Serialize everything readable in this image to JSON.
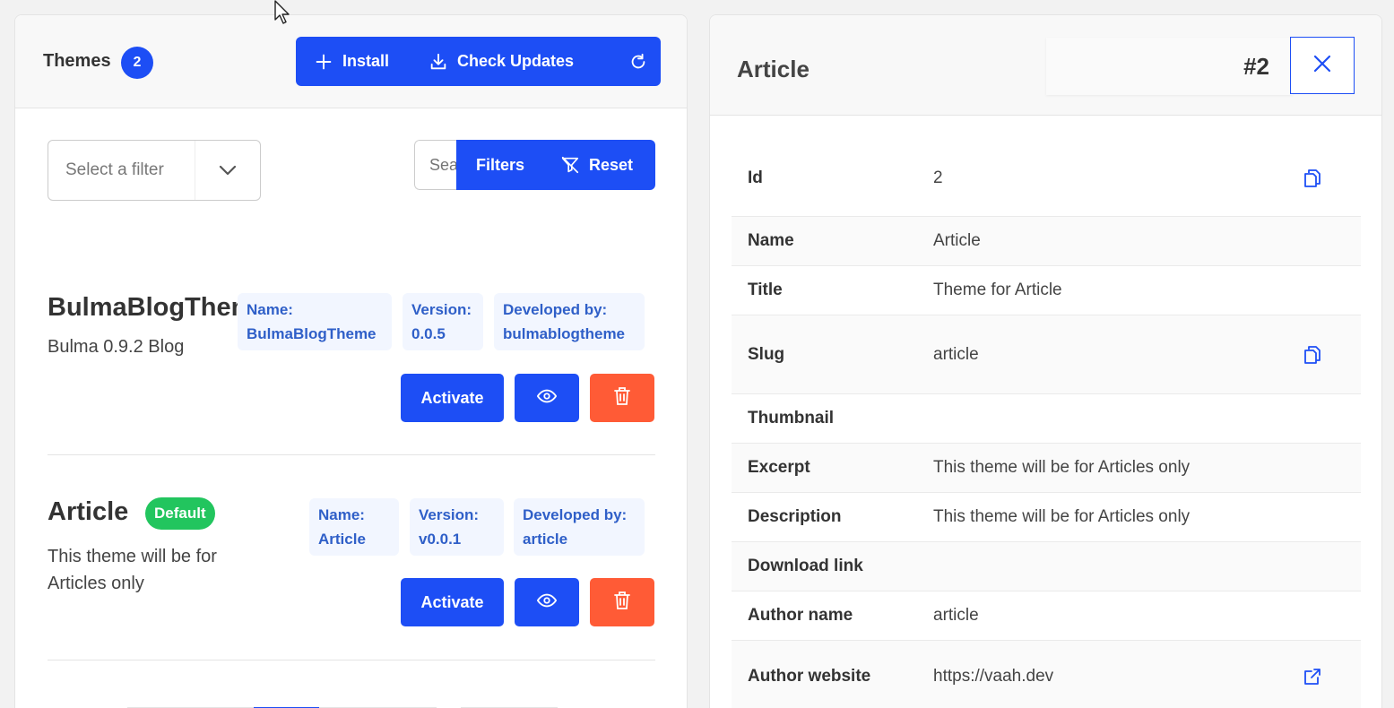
{
  "left": {
    "title": "Themes",
    "count": "2",
    "buttons": {
      "install": "Install",
      "check_updates": "Check Updates"
    },
    "filter": {
      "placeholder": "Select a filter"
    },
    "search": {
      "placeholder": "Search"
    },
    "filters_label": "Filters",
    "reset_label": "Reset",
    "themes": [
      {
        "name": "BulmaBlogTheme",
        "description": "Bulma 0.9.2 Blog",
        "meta_name_label": "Name:",
        "meta_name_value": "BulmaBlogTheme",
        "meta_version_label": "Version:",
        "meta_version_value": "0.0.5",
        "meta_dev_label": "Developed by:",
        "meta_dev_value": "bulmablogtheme",
        "activate_label": "Activate"
      },
      {
        "name": "Article",
        "badge": "Default",
        "description_line1": "This theme will be for",
        "description_line2": "Articles only",
        "meta_name_label": "Name:",
        "meta_name_value": "Article",
        "meta_version_label": "Version:",
        "meta_version_value": "v0.0.1",
        "meta_dev_label": "Developed by:",
        "meta_dev_value": "article",
        "activate_label": "Activate"
      }
    ]
  },
  "right": {
    "title": "Article",
    "record_number": "#2",
    "rows": [
      {
        "label": "Id",
        "value": "2"
      },
      {
        "label": "Name",
        "value": "Article"
      },
      {
        "label": "Title",
        "value": "Theme for Article"
      },
      {
        "label": "Slug",
        "value": "article"
      },
      {
        "label": "Thumbnail",
        "value": ""
      },
      {
        "label": "Excerpt",
        "value": "This theme will be for Articles only"
      },
      {
        "label": "Description",
        "value": "This theme will be for Articles only"
      },
      {
        "label": "Download link",
        "value": ""
      },
      {
        "label": "Author name",
        "value": "article"
      },
      {
        "label": "Author website",
        "value": "https://vaah.dev"
      }
    ]
  },
  "colors": {
    "primary": "#1d4ef5",
    "danger": "#ff5b36",
    "success": "#22c55e",
    "meta_text": "#2f5fc8"
  },
  "icons": [
    "plus-icon",
    "download-icon",
    "refresh-icon",
    "chevron-down-icon",
    "filter-slash-icon",
    "eye-icon",
    "trash-icon",
    "close-icon",
    "copy-icon",
    "external-link-icon",
    "mouse-cursor-icon"
  ]
}
